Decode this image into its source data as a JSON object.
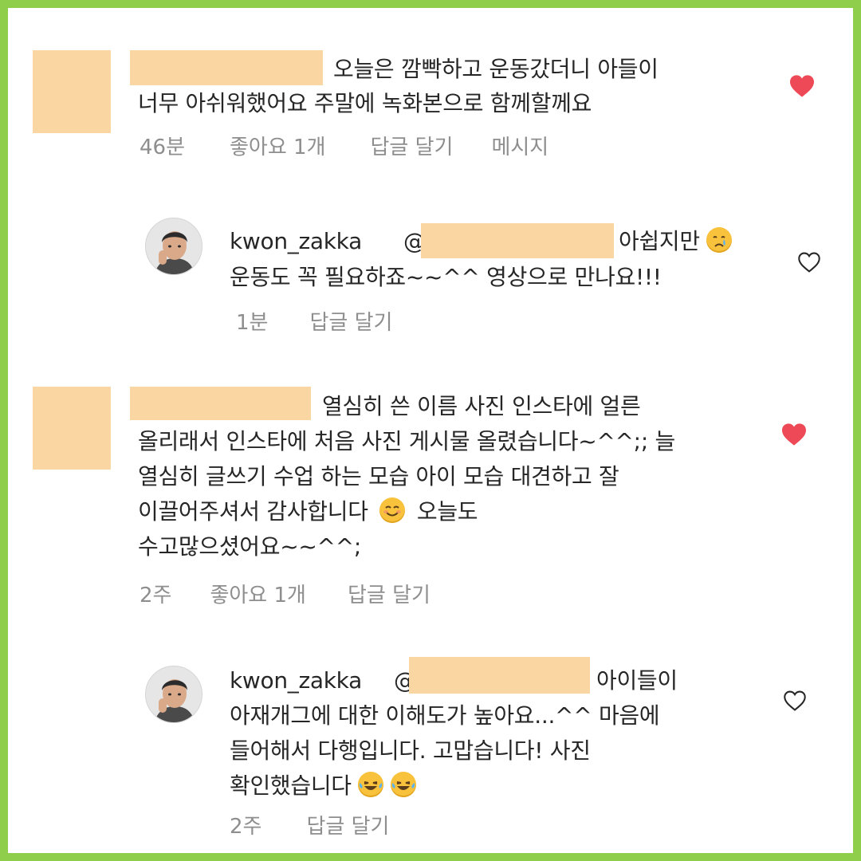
{
  "comments": [
    {
      "text_lines": [
        "오늘은  깜빡하고 운동갔더니 아들이",
        "너무 아쉬워했어요  주말에 녹화본으로 함께할께요"
      ],
      "time": "46분",
      "likes": "좋아요 1개",
      "reply": "답글 달기",
      "message": "메시지",
      "liked": true,
      "reply_item": {
        "username": "kwon_zakka",
        "at": "@",
        "text_line1_suffix": "아쉽지만",
        "text_line2": "운동도 꼭 필요하죠~~^^  영상으로 만나요!!!",
        "time": "1분",
        "reply": "답글 달기",
        "liked": false
      }
    },
    {
      "text_lines": [
        "열심히 쓴 이름 사진 인스타에 얼른",
        "올리래서 인스타에 처음 사진 게시물 올렸습니다~^^;; 늘",
        "열심히 글쓰기 수업 하는 모습 아이 모습 대견하고 잘",
        "이끌어주셔서 감사합니다",
        "오늘도",
        "수고많으셨어요~~^^;"
      ],
      "time": "2주",
      "likes": "좋아요 1개",
      "reply": "답글 달기",
      "liked": true,
      "reply_item": {
        "username": "kwon_zakka",
        "at": "@",
        "text_line1_suffix": "아이들이",
        "text_line2": "아재개그에 대한 이해도가 높아요...^^ 마음에",
        "text_line3": "들어해서 다행입니다. 고맙습니다! 사진",
        "text_line4": "확인했습니다",
        "time": "2주",
        "reply": "답글 달기",
        "liked": false
      }
    }
  ],
  "colors": {
    "frame": "#8fce4a",
    "redaction": "#fad7a2",
    "heart_liked": "#ed4956",
    "meta_text": "#8e8e8e"
  },
  "icons": {
    "liked": "heart-filled-icon",
    "unliked": "heart-outline-icon",
    "sad": "crying-face-emoji",
    "smile": "smiling-face-emoji",
    "laugh": "tears-of-joy-emoji"
  }
}
